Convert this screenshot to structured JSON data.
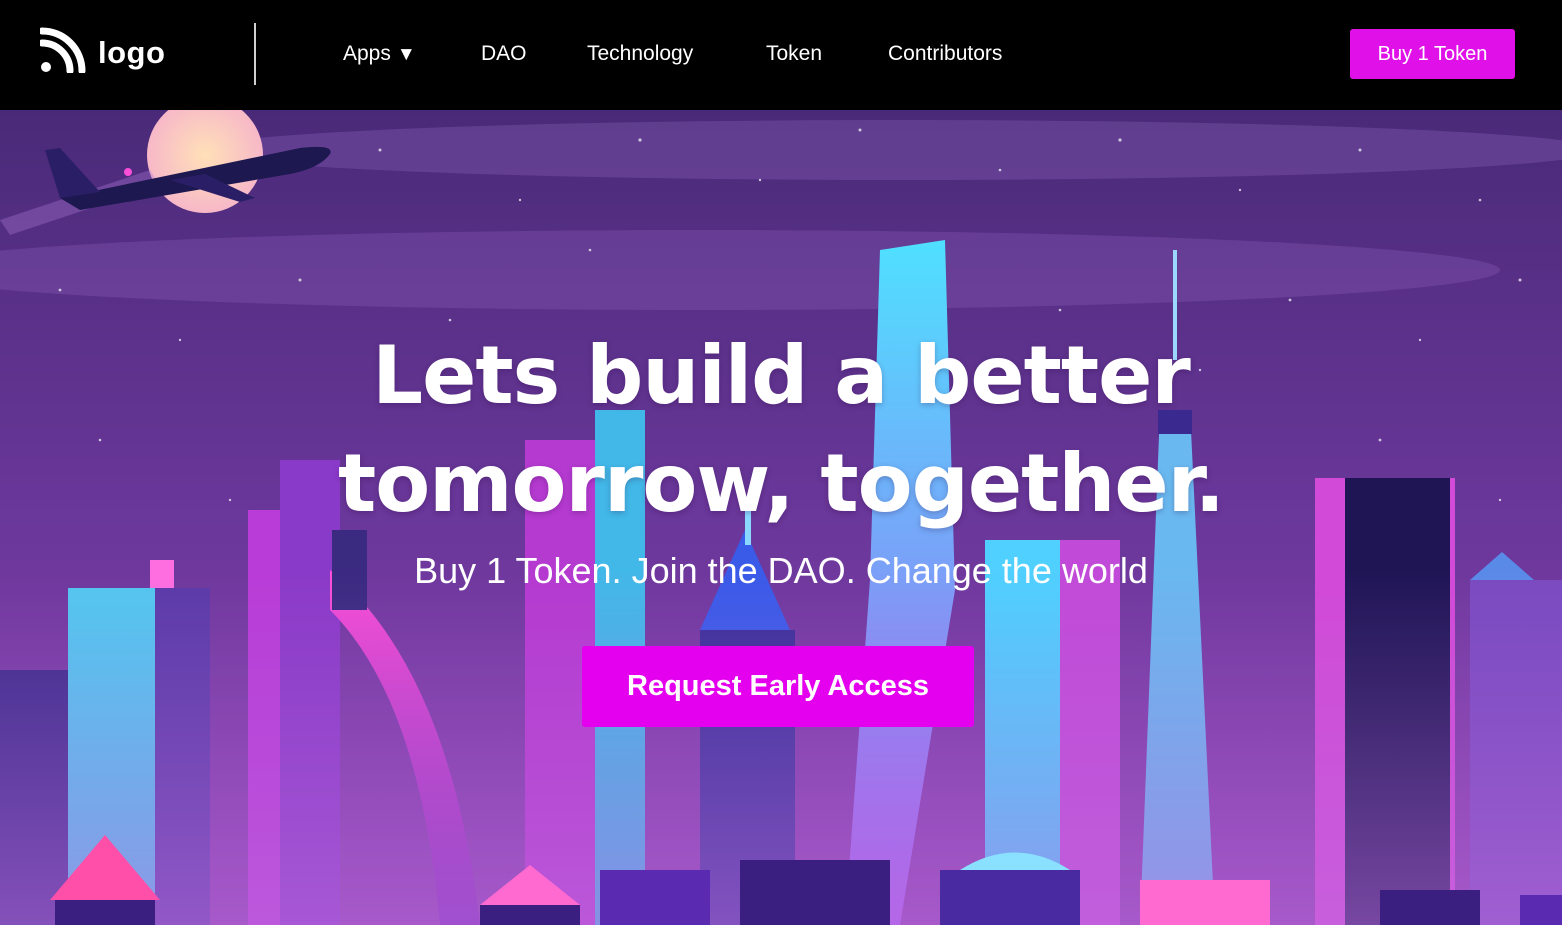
{
  "navbar": {
    "logo_text": "logo",
    "logo_icon": "rss-wave-icon",
    "links": [
      {
        "label": "Apps",
        "has_dropdown": true,
        "caret": "▼"
      },
      {
        "label": "DAO"
      },
      {
        "label": "Technology"
      },
      {
        "label": "Token"
      },
      {
        "label": "Contributors"
      }
    ],
    "cta_label": "Buy 1 Token"
  },
  "hero": {
    "headline_line1": "Lets build a better",
    "headline_line2": "tomorrow, together.",
    "subheadline": "Buy 1 Token. Join the DAO. Change the world",
    "cta_label": "Request Early Access",
    "background": "neon-city-skyline-illustration"
  },
  "colors": {
    "accent": "#e011e8",
    "navbar_bg": "#000000",
    "sky_top": "#4a2a78",
    "sky_bottom": "#7a3aa8"
  }
}
